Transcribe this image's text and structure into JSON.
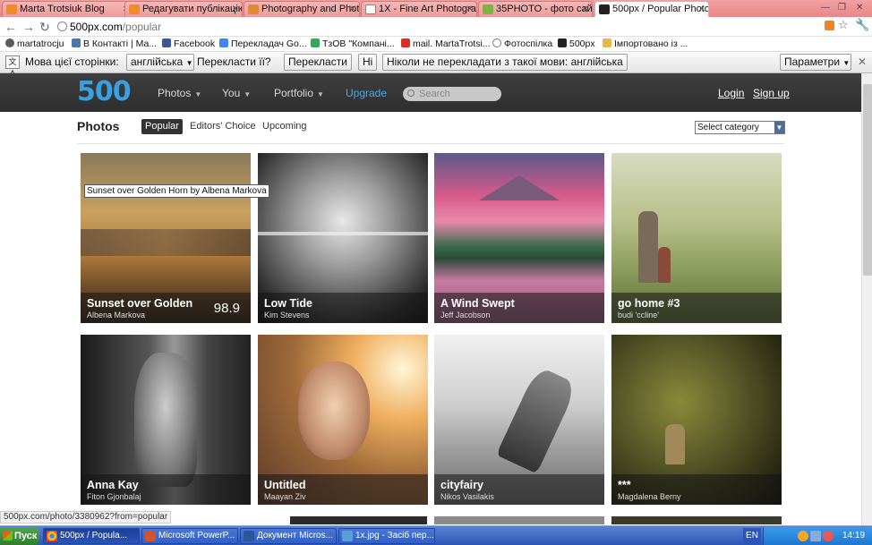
{
  "browser": {
    "tabs": [
      {
        "label": "Marta Trotsiuk Blog",
        "active": false
      },
      {
        "label": "Редагувати публікацію",
        "active": false
      },
      {
        "label": "Photography and Photo",
        "active": false
      },
      {
        "label": "1X - Fine Art Photograph",
        "active": false
      },
      {
        "label": "35PHOTO - фото сайт",
        "active": false
      },
      {
        "label": "500px / Popular Photos",
        "active": true
      }
    ],
    "address": {
      "host": "500px.com",
      "path": "/popular"
    },
    "bookmarks": [
      {
        "label": "martatrocju",
        "color": "#5a5a5a"
      },
      {
        "label": "В Контакті | Ма...",
        "color": "#4a76a8"
      },
      {
        "label": "Facebook",
        "color": "#3b5998"
      },
      {
        "label": "Перекладач Go...",
        "color": "#4285f4"
      },
      {
        "label": "ТзОВ \"Компані...",
        "color": "#34a853"
      },
      {
        "label": "mail. MartaTrotsi...",
        "color": "#d93025"
      },
      {
        "label": "Фотоспілка",
        "color": "#777777"
      },
      {
        "label": "500px",
        "color": "#222222"
      },
      {
        "label": "Імпортовано із ...",
        "color": "#e8b84a"
      }
    ]
  },
  "translate_bar": {
    "prompt": "Мова цієї сторінки:",
    "language": "англійська",
    "question": "Перекласти її?",
    "translate_button": "Перекласти",
    "no_button": "Ні",
    "never_button": "Ніколи не перекладати з такої мови: англійська",
    "options_button": "Параметри"
  },
  "site": {
    "logo": "500",
    "nav": {
      "photos": "Photos",
      "you": "You",
      "portfolio": "Portfolio",
      "upgrade": "Upgrade"
    },
    "search_placeholder": "Search",
    "login": "Login",
    "signup": "Sign up",
    "section_title": "Photos",
    "subtabs": {
      "popular": "Popular",
      "editors_choice": "Editors' Choice",
      "upcoming": "Upcoming"
    },
    "category_select": "Select category",
    "tooltip": "Sunset over Golden Horn by Albena Markova",
    "photos": [
      {
        "title": "Sunset over Golden",
        "author": "Albena Markova",
        "score": "98.9"
      },
      {
        "title": "Low Tide",
        "author": "Kim Stevens"
      },
      {
        "title": "A Wind Swept",
        "author": "Jeff Jacobson"
      },
      {
        "title": "go home #3",
        "author": "budi 'ccline'"
      },
      {
        "title": "Anna Kay",
        "author": "Fiton Gjonbalaj"
      },
      {
        "title": "Untitled",
        "author": "Maayan Ziv"
      },
      {
        "title": "cityfairy",
        "author": "Nikos Vasilakis"
      },
      {
        "title": "***",
        "author": "Magdalena Berny"
      }
    ]
  },
  "status_url": "500px.com/photo/3380962?from=popular",
  "taskbar": {
    "start": "Пуск",
    "tasks": [
      {
        "label": "500px / Popula...",
        "active": true
      },
      {
        "label": "Microsoft PowerP...",
        "active": false
      },
      {
        "label": "Документ Micros...",
        "active": false
      },
      {
        "label": "1x.jpg - Засіб пер...",
        "active": false
      }
    ],
    "lang": "EN",
    "clock": "14:19"
  }
}
